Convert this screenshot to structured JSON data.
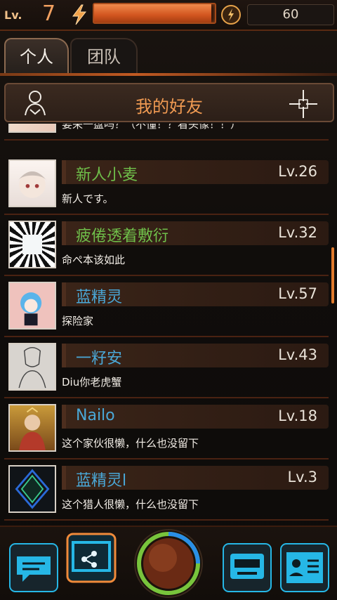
{
  "header": {
    "level_label": "Lv.",
    "level_value": "7",
    "energy_fraction": 0.97,
    "coins": "60"
  },
  "tabs": [
    {
      "label": "个人",
      "active": true
    },
    {
      "label": "团队",
      "active": false
    }
  ],
  "panel": {
    "title": "我的好友"
  },
  "friends": [
    {
      "name": "",
      "level": "",
      "bio": "要来一盘吗？（不懂！？看头像！！）",
      "name_color": "#6fbf4a"
    },
    {
      "name": "新人小麦",
      "level": "Lv.26",
      "bio": "新人です。",
      "name_color": "#6fbf4a"
    },
    {
      "name": "疲倦透着敷衍",
      "level": "Lv.32",
      "bio": "命ぺ本该如此",
      "name_color": "#6fbf4a"
    },
    {
      "name": "蓝精灵",
      "level": "Lv.57",
      "bio": "探险家",
      "name_color": "#4aa8d8"
    },
    {
      "name": "一籽安",
      "level": "Lv.43",
      "bio": "Diu你老虎蟹",
      "name_color": "#4aa8d8"
    },
    {
      "name": "Nailo",
      "level": "Lv.18",
      "bio": "这个家伙很懒，什么也没留下",
      "name_color": "#4aa8d8"
    },
    {
      "name": "蓝精灵l",
      "level": "Lv.3",
      "bio": "这个猎人很懒，什么也没留下",
      "name_color": "#4aa8d8"
    }
  ],
  "colors": {
    "accent_orange": "#f09a52",
    "nav_cyan": "#26b7e6",
    "orb_green": "#78c43c",
    "orb_blue": "#2a8fe6"
  },
  "icons": {
    "bolt": "bolt-icon",
    "coin": "coin-icon",
    "person": "person-icon",
    "add": "add-friend-icon",
    "chat": "chat-icon",
    "share": "share-icon",
    "store": "store-icon",
    "profile": "profile-card-icon"
  }
}
